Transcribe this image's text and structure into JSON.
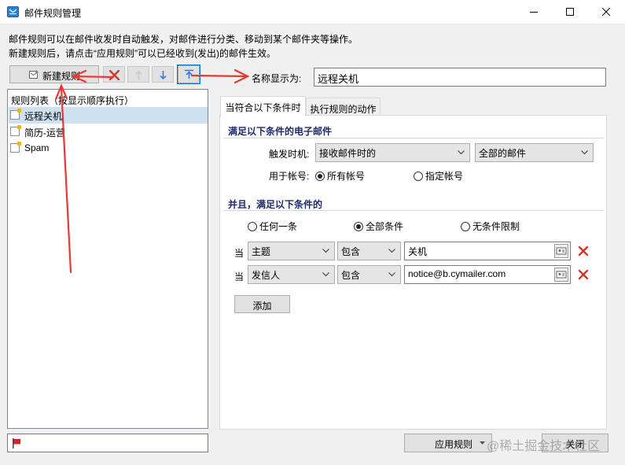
{
  "window": {
    "title": "邮件规则管理"
  },
  "description": {
    "line1": "邮件规则可以在邮件收发时自动触发，对邮件进行分类、移动到某个邮件夹等操作。",
    "line2": "新建规则后，请点击“应用规则”可以已经收到(发出)的邮件生效。"
  },
  "toolbar": {
    "new_rule_label": "新建规则"
  },
  "name_field": {
    "label": "名称显示为:",
    "value": "远程关机"
  },
  "rule_list": {
    "header": "规则列表（按显示顺序执行）",
    "items": [
      {
        "label": "远程关机",
        "selected": true
      },
      {
        "label": "简历-运营"
      },
      {
        "label": "Spam"
      }
    ]
  },
  "tabs": [
    {
      "label": "当符合以下条件时",
      "active": true
    },
    {
      "label": "执行规则的动作"
    }
  ],
  "conditions": {
    "section1_title": "满足以下条件的电子邮件",
    "trigger_label": "触发时机:",
    "trigger_value": "接收邮件时的",
    "scope_value": "全部的邮件",
    "account_label": "用于帐号:",
    "account_all": "所有帐号",
    "account_specific": "指定帐号",
    "section2_title": "并且，满足以下条件的",
    "match_any": "任何一条",
    "match_all": "全部条件",
    "match_none": "无条件限制",
    "rows": [
      {
        "prefix": "当",
        "field": "主题",
        "op": "包含",
        "value": "关机"
      },
      {
        "prefix": "当",
        "field": "发信人",
        "op": "包含",
        "value": "notice@b.cymailer.com"
      }
    ],
    "add_label": "添加"
  },
  "footer": {
    "apply_label": "应用规则",
    "close_label": "关闭"
  },
  "watermark": "@稀土掘金技术社区",
  "colors": {
    "accent_blue": "#0078d7",
    "arrow_red": "#e53935",
    "section_title": "#1f2a6e",
    "selection": "#cde1f0"
  }
}
